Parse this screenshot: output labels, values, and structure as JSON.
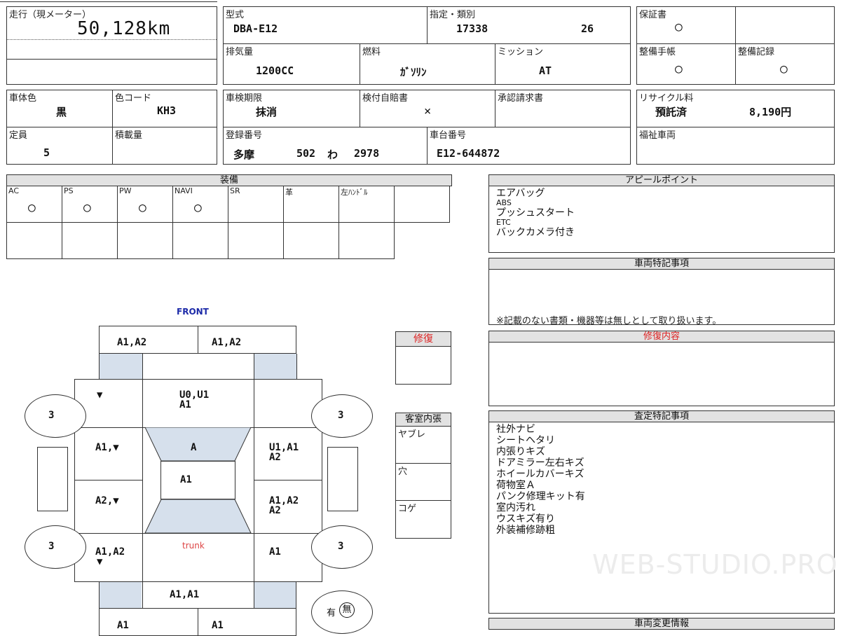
{
  "mileage": {
    "label": "走行（現メーター）",
    "value": "50,128km"
  },
  "model": {
    "label": "型式",
    "value": "DBA-E12"
  },
  "designation": {
    "label": "指定・類別",
    "value1": "17338",
    "value2": "26"
  },
  "warranty": {
    "label": "保証書",
    "value": "○"
  },
  "displacement": {
    "label": "排気量",
    "value": "1200CC"
  },
  "fuel": {
    "label": "燃料",
    "value": "ｶﾞｿﾘﾝ"
  },
  "transmission": {
    "label": "ミッション",
    "value": "AT"
  },
  "maintenance_book": {
    "label": "整備手帳",
    "value": "○"
  },
  "maintenance_record": {
    "label": "整備記録",
    "value": "○"
  },
  "body_color": {
    "label": "車体色",
    "value": "黒"
  },
  "color_code": {
    "label": "色コード",
    "value": "KH3"
  },
  "inspection": {
    "label": "車検期限",
    "value": "抹消"
  },
  "insurance": {
    "label": "検付自賠書",
    "value": "×"
  },
  "approval": {
    "label": "承認請求書",
    "value": ""
  },
  "recycle": {
    "label": "リサイクル料",
    "status": "預託済",
    "amount": "8,190円"
  },
  "capacity": {
    "label": "定員",
    "value": "5"
  },
  "load": {
    "label": "積載量",
    "value": ""
  },
  "registration": {
    "label": "登録番号",
    "area": "多摩",
    "class": "502",
    "kana": "わ",
    "number": "2978"
  },
  "chassis": {
    "label": "車台番号",
    "value": "E12-644872"
  },
  "welfare": {
    "label": "福祉車両",
    "value": ""
  },
  "equipment": {
    "title": "装備",
    "items": [
      {
        "label": "AC",
        "value": "○"
      },
      {
        "label": "PS",
        "value": "○"
      },
      {
        "label": "PW",
        "value": "○"
      },
      {
        "label": "NAVI",
        "value": "○"
      },
      {
        "label": "SR",
        "value": ""
      },
      {
        "label": "革",
        "value": ""
      },
      {
        "label": "左ﾊﾝﾄﾞﾙ",
        "value": ""
      }
    ]
  },
  "appeal": {
    "title": "アピールポイント",
    "lines": [
      "エアバッグ",
      "ABS",
      "プッシュスタート",
      "ETC",
      "バックカメラ付き"
    ]
  },
  "special_notes": {
    "title": "車両特記事項",
    "note": "※記載のない書類・機器等は無しとして取り扱います。"
  },
  "repair_content": {
    "title": "修復内容"
  },
  "repair_box": {
    "title": "修復"
  },
  "interior": {
    "title": "客室内張",
    "items": [
      "ヤブレ",
      "穴",
      "コゲ"
    ]
  },
  "assessment": {
    "title": "査定特記事項",
    "lines": [
      "社外ナビ",
      "シートヘタリ",
      "内張りキズ",
      "ドアミラー左右キズ",
      "ホイールカバーキズ",
      "荷物室Ａ",
      "パンク修理キット有",
      "室内汚れ",
      "ウスキズ有り",
      "外装補修跡粗"
    ]
  },
  "change_info": {
    "title": "車両変更情報"
  },
  "diagram": {
    "front": "FRONT",
    "trunk": "trunk",
    "top_left": "A1,A2",
    "top_right": "A1,A2",
    "roof_front": "U0,U1",
    "roof_front2": "A1",
    "windshield": "A",
    "roof": "A1",
    "left_front": "▼",
    "left_door1": "A1,▼",
    "left_door2": "A2,▼",
    "left_rear_a": "A1,A2",
    "left_rear_b": "▼",
    "right_front_a": "U1,A1",
    "right_front_b": "A2",
    "right_door_a": "A1,A2",
    "right_door_b": "A2",
    "right_rear": "A1",
    "rear_bumper": "A1,A1",
    "bottom_left": "A1",
    "bottom_right": "A1",
    "tire_fl": "3",
    "tire_fr": "3",
    "tire_rl": "3",
    "tire_rr": "3",
    "spare_a": "有",
    "spare_b": "無"
  },
  "watermark": "WEB-STUDIO.PRO"
}
